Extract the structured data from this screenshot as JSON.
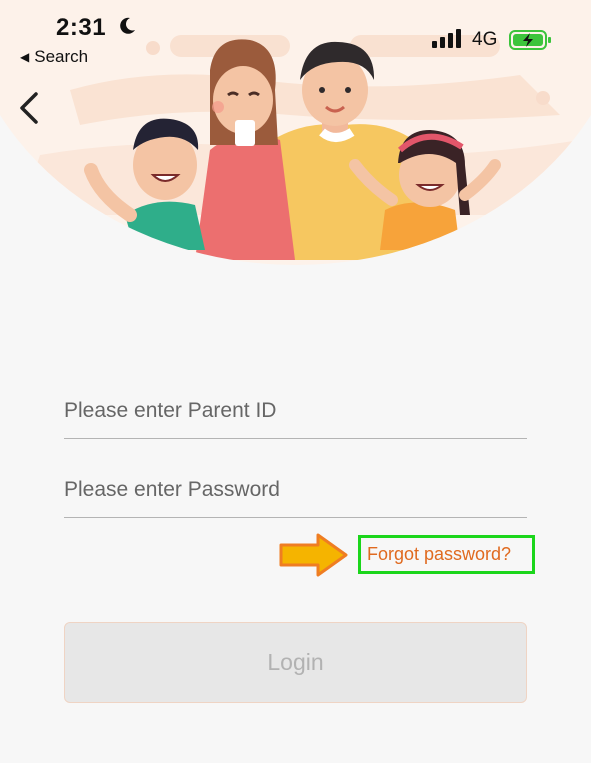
{
  "status_bar": {
    "time": "2:31",
    "back_app": "Search",
    "network": "4G"
  },
  "form": {
    "parent_id_placeholder": "Please enter Parent ID",
    "password_placeholder": "Please enter Password",
    "forgot_password_label": "Forgot password?",
    "login_label": "Login"
  },
  "icons": {
    "back": "chevron-left-icon",
    "moon": "moon-icon",
    "signal": "cellular-signal-icon",
    "battery": "battery-charging-icon",
    "annotation_arrow": "arrow-right-icon"
  },
  "colors": {
    "background": "#f7f7f7",
    "forgot_link": "#e06a1f",
    "highlight_box": "#1bd61b",
    "arrow": "#f5b400",
    "login_disabled_bg": "#e7e7e7",
    "battery": "#3cc43c"
  }
}
